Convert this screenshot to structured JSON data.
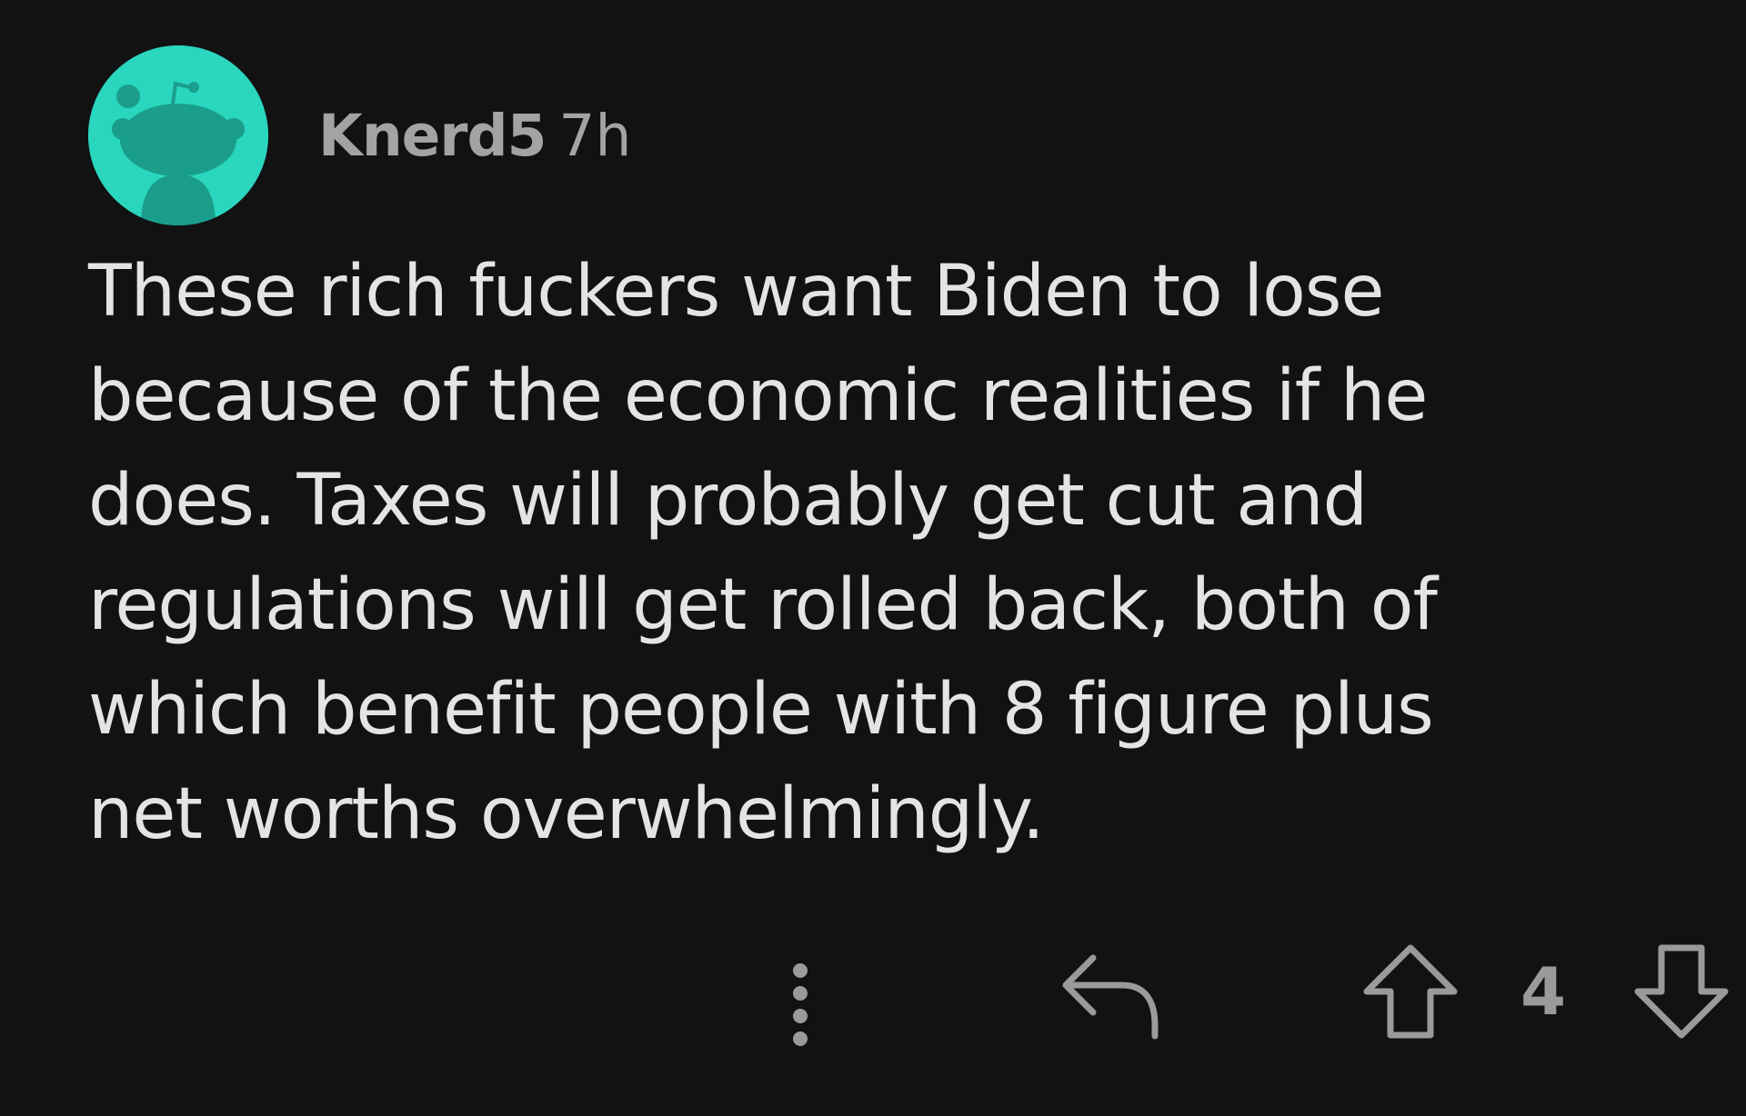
{
  "comment": {
    "author": "Knerd5",
    "timestamp": "7h",
    "avatar_icon": "reddit-snoo-avatar-icon",
    "avatar_color": "#2ad6be",
    "body_lines": [
      "These rich fuckers want Biden to lose",
      "because of the economic realities if he",
      "does. Taxes will probably get cut and",
      "regulations will get rolled back, both of",
      "which benefit people with 8 figure plus",
      "net worths overwhelmingly."
    ]
  },
  "actions": {
    "more_icon": "more-vertical-icon",
    "reply_icon": "reply-arrow-icon",
    "upvote_icon": "upvote-arrow-icon",
    "score": "4",
    "downvote_icon": "downvote-arrow-icon"
  },
  "colors": {
    "background": "#121212",
    "text": "#e4e4e4",
    "meta_text": "#a3a3a3",
    "icon": "#9a9a9a"
  }
}
